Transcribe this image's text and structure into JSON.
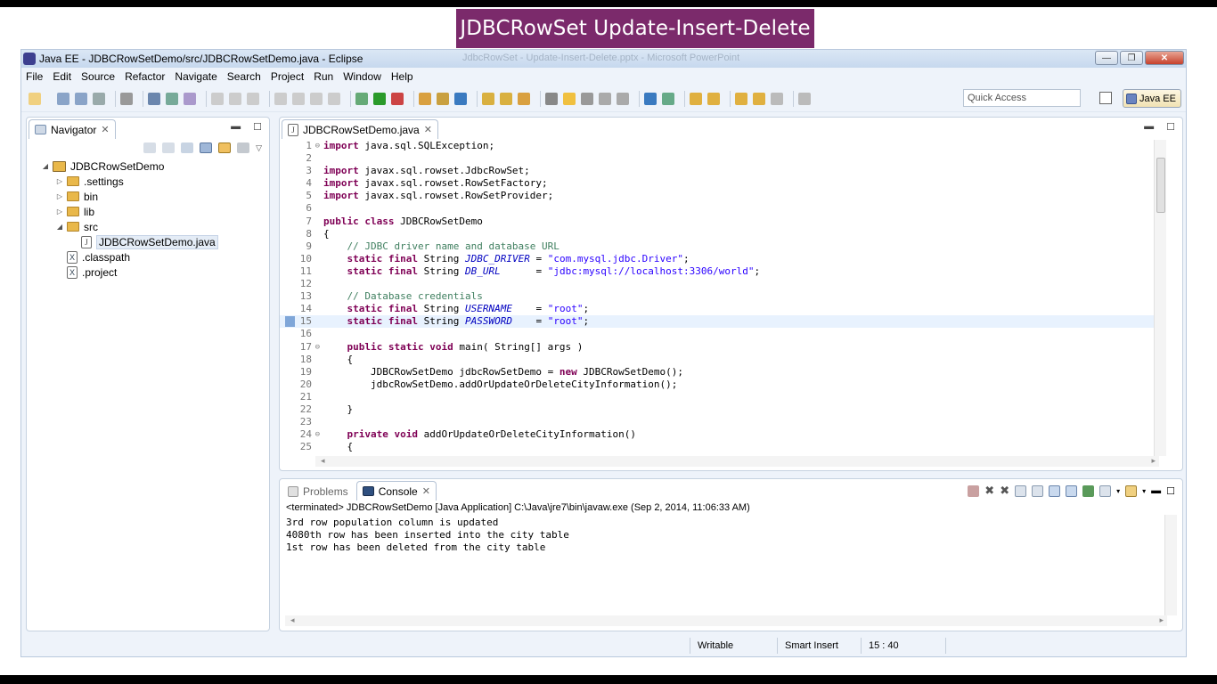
{
  "slide_title": "JDBCRowSet Update-Insert-Delete",
  "window": {
    "title": "Java EE - JDBCRowSetDemo/src/JDBCRowSetDemo.java - Eclipse",
    "ghost_title": "JdbcRowSet - Update-Insert-Delete.pptx - Microsoft PowerPoint",
    "buttons": {
      "minimize": "—",
      "restore": "❐",
      "close": "✕"
    }
  },
  "menu": [
    "File",
    "Edit",
    "Source",
    "Refactor",
    "Navigate",
    "Search",
    "Project",
    "Run",
    "Window",
    "Help"
  ],
  "toolbar": {
    "quick_access_placeholder": "Quick Access",
    "perspective_label": "Java EE"
  },
  "navigator": {
    "tab_label": "Navigator",
    "tree": [
      {
        "label": "JDBCRowSetDemo",
        "type": "project",
        "level": 0,
        "expanded": true
      },
      {
        "label": ".settings",
        "type": "folder",
        "level": 1,
        "expanded": false
      },
      {
        "label": "bin",
        "type": "folder",
        "level": 1,
        "expanded": false
      },
      {
        "label": "lib",
        "type": "folder",
        "level": 1,
        "expanded": false
      },
      {
        "label": "src",
        "type": "folder",
        "level": 1,
        "expanded": true
      },
      {
        "label": "JDBCRowSetDemo.java",
        "type": "java",
        "level": 2,
        "selected": true
      },
      {
        "label": ".classpath",
        "type": "xml",
        "level": 1
      },
      {
        "label": ".project",
        "type": "xml",
        "level": 1
      }
    ]
  },
  "editor": {
    "tab_label": "JDBCRowSetDemo.java",
    "highlighted_line": 15,
    "lines": [
      {
        "n": "1",
        "fold": true,
        "html": "<span class=\"kw\">import</span> java.sql.SQLException;"
      },
      {
        "n": "2",
        "html": ""
      },
      {
        "n": "3",
        "html": "<span class=\"kw\">import</span> javax.sql.rowset.JdbcRowSet;"
      },
      {
        "n": "4",
        "html": "<span class=\"kw\">import</span> javax.sql.rowset.RowSetFactory;"
      },
      {
        "n": "5",
        "html": "<span class=\"kw\">import</span> javax.sql.rowset.RowSetProvider;"
      },
      {
        "n": "6",
        "html": ""
      },
      {
        "n": "7",
        "html": "<span class=\"kw\">public class</span> JDBCRowSetDemo"
      },
      {
        "n": "8",
        "html": "{"
      },
      {
        "n": "9",
        "html": "    <span class=\"cm\">// JDBC driver name and database URL</span>"
      },
      {
        "n": "10",
        "html": "    <span class=\"kw\">static final</span> String <span class=\"it\">JDBC_DRIVER</span> = <span class=\"str\">\"com.mysql.jdbc.Driver\"</span>;"
      },
      {
        "n": "11",
        "html": "    <span class=\"kw\">static final</span> String <span class=\"it\">DB_URL</span>      = <span class=\"str\">\"jdbc:mysql://localhost:3306/world\"</span>;"
      },
      {
        "n": "12",
        "html": ""
      },
      {
        "n": "13",
        "html": "    <span class=\"cm\">// Database credentials</span>"
      },
      {
        "n": "14",
        "html": "    <span class=\"kw\">static final</span> String <span class=\"it\">USERNAME</span>    = <span class=\"str\">\"root\"</span>;"
      },
      {
        "n": "15",
        "html": "    <span class=\"kw\">static final</span> String <span class=\"it\">PASSWORD</span>    = <span class=\"str\">\"root\"</span>;"
      },
      {
        "n": "16",
        "html": ""
      },
      {
        "n": "17",
        "fold": true,
        "html": "    <span class=\"kw\">public static void</span> main( String[] args )"
      },
      {
        "n": "18",
        "html": "    {"
      },
      {
        "n": "19",
        "html": "        JDBCRowSetDemo jdbcRowSetDemo = <span class=\"kw\">new</span> JDBCRowSetDemo();"
      },
      {
        "n": "20",
        "html": "        jdbcRowSetDemo.addOrUpdateOrDeleteCityInformation();"
      },
      {
        "n": "21",
        "html": ""
      },
      {
        "n": "22",
        "html": "    }"
      },
      {
        "n": "23",
        "html": ""
      },
      {
        "n": "24",
        "fold": true,
        "html": "    <span class=\"kw\">private void</span> addOrUpdateOrDeleteCityInformation()"
      },
      {
        "n": "25",
        "html": "    {"
      }
    ]
  },
  "console": {
    "problems_tab": "Problems",
    "console_tab": "Console",
    "header": "<terminated> JDBCRowSetDemo [Java Application] C:\\Java\\jre7\\bin\\javaw.exe (Sep 2, 2014, 11:06:33 AM)",
    "output": [
      "3rd row population column is updated",
      "4080th row has been inserted into the city table",
      "1st row has been deleted from the city table"
    ]
  },
  "status": {
    "writable": "Writable",
    "insert_mode": "Smart Insert",
    "position": "15 : 40"
  },
  "colors": {
    "slide_title_bg": "#7b2a6b",
    "keyword": "#7f0055",
    "string": "#2a00ff",
    "comment": "#3f7f5f",
    "field": "#0000c0",
    "current_line": "#e8f2fe"
  }
}
